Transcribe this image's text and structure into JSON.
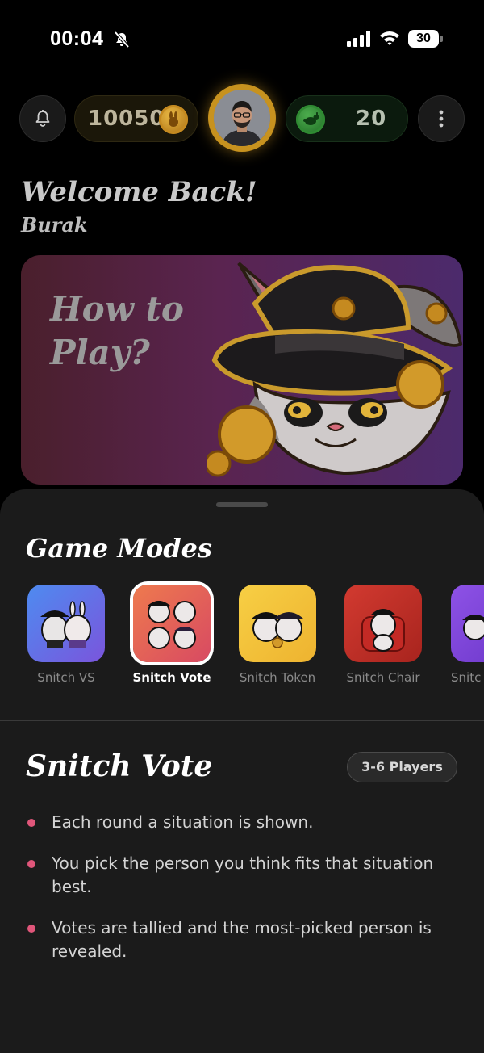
{
  "status_bar": {
    "time": "00:04",
    "battery": "30"
  },
  "header": {
    "coins": "10050",
    "tokens": "20"
  },
  "greeting": {
    "welcome": "Welcome Back!",
    "username": "Burak"
  },
  "banner": {
    "title": "How to\nPlay?"
  },
  "game_modes": {
    "title": "Game Modes",
    "items": [
      {
        "label": "Snitch VS",
        "color": "#5b7be8"
      },
      {
        "label": "Snitch Vote",
        "color": "#e8704f"
      },
      {
        "label": "Snitch Token",
        "color": "#f3c43a"
      },
      {
        "label": "Snitch Chair",
        "color": "#c2332c"
      },
      {
        "label": "Snitc",
        "color": "#7a42d6"
      }
    ],
    "selected": "Snitch Vote"
  },
  "detail": {
    "title": "Snitch Vote",
    "players": "3-6 Players",
    "rules": [
      "Each round a situation is shown.",
      "You pick the person you think fits that situation best.",
      "Votes are tallied and the most-picked person is revealed."
    ]
  }
}
